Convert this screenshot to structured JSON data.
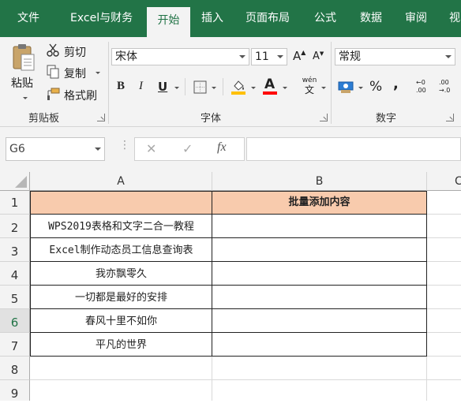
{
  "menu": {
    "tabs": [
      {
        "label": "文件"
      },
      {
        "label": "Excel与财务"
      },
      {
        "label": "开始"
      },
      {
        "label": "插入"
      },
      {
        "label": "页面布局"
      },
      {
        "label": "公式"
      },
      {
        "label": "数据"
      },
      {
        "label": "审阅"
      },
      {
        "label": "视"
      }
    ],
    "active_tab": "开始",
    "bar_color": "#227447"
  },
  "ribbon": {
    "clipboard": {
      "label": "剪贴板",
      "paste": "粘贴",
      "cut": "剪切",
      "copy": "复制",
      "format_painter": "格式刷"
    },
    "font": {
      "label": "字体",
      "font_name": "宋体",
      "font_size": "11",
      "bold": "B",
      "italic": "I",
      "underline": "U",
      "font_color_glyph": "A",
      "grow_glyph": "A",
      "shrink_glyph": "A",
      "phonetic_top": "wén",
      "phonetic_bottom": "文",
      "font_color": "#ff0000",
      "fill_color": "#ffc000"
    },
    "number": {
      "label": "数字",
      "format": "常规",
      "percent": "%",
      "comma": ",",
      "increase_decimal_top": "←0",
      "increase_decimal_bottom": ".00",
      "decrease_decimal_top": ".00",
      "decrease_decimal_bottom": "→.0"
    }
  },
  "formula_bar": {
    "name_box": "G6",
    "cancel_glyph": "✕",
    "enter_glyph": "✓",
    "fx": "fx",
    "value": ""
  },
  "sheet": {
    "columns": [
      "A",
      "B",
      "C"
    ],
    "rows": [
      "1",
      "2",
      "3",
      "4",
      "5",
      "6",
      "7",
      "8",
      "9"
    ],
    "header_fill": "#f8cbad",
    "b1": "批量添加内容",
    "a_values": [
      "WPS2019表格和文字二合一教程",
      "Excel制作动态员工信息查询表",
      "我亦飘零久",
      "一切都是最好的安排",
      "春风十里不如你",
      "平凡的世界"
    ]
  }
}
